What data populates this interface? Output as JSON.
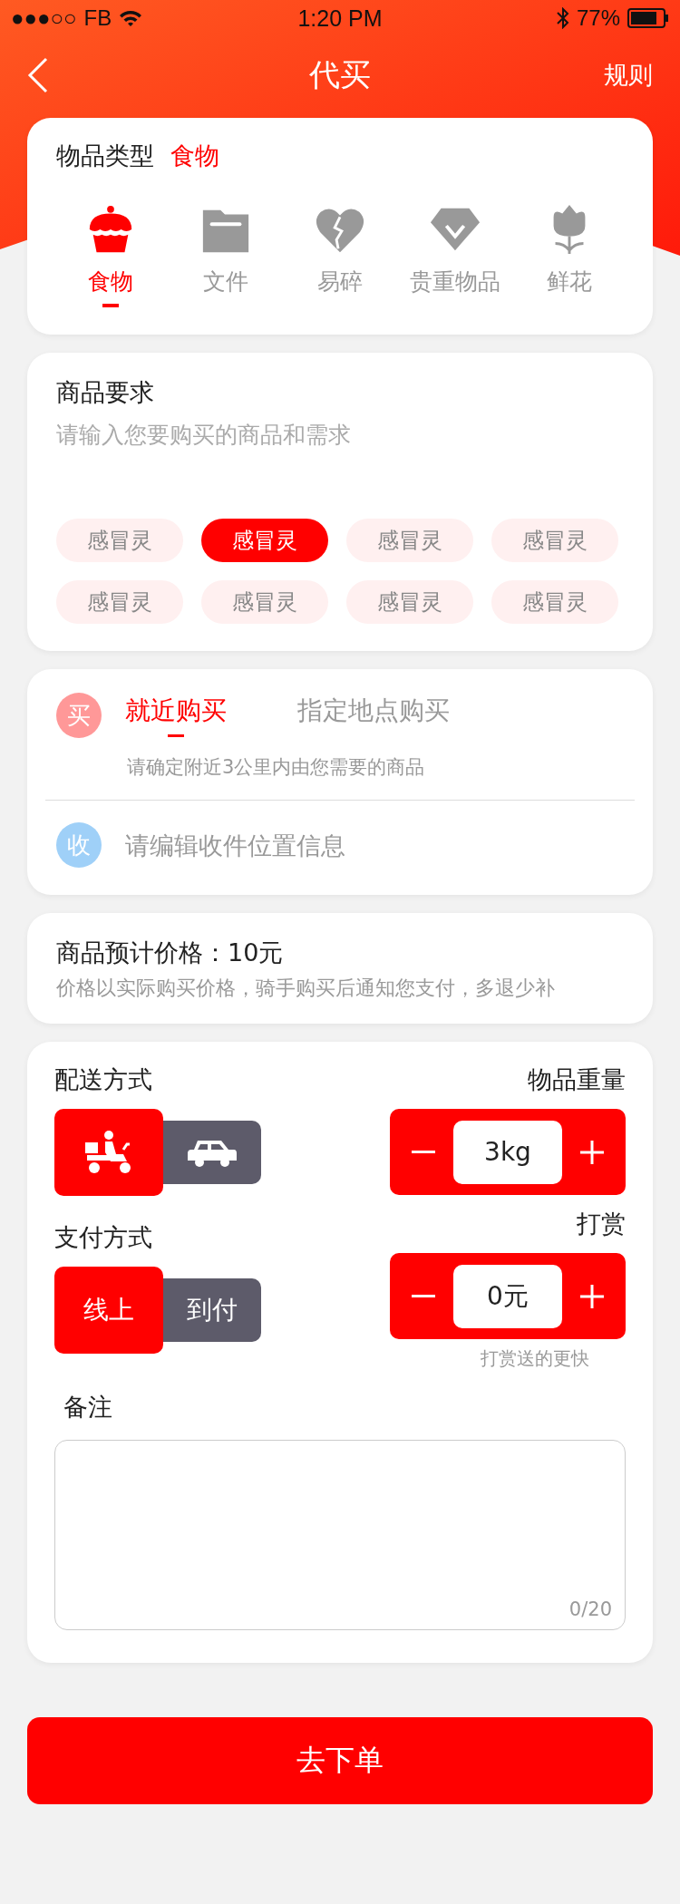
{
  "status_bar": {
    "signal": "●●●○○",
    "carrier": "FB",
    "time": "1:20 PM",
    "battery": "77%"
  },
  "header": {
    "title": "代买",
    "right_link": "规则"
  },
  "item_type": {
    "label": "物品类型",
    "value": "食物",
    "categories": [
      {
        "label": "食物",
        "kind": "cake",
        "selected": true
      },
      {
        "label": "文件",
        "kind": "folder",
        "selected": false
      },
      {
        "label": "易碎",
        "kind": "heart",
        "selected": false
      },
      {
        "label": "贵重物品",
        "kind": "diamond",
        "selected": false
      },
      {
        "label": "鲜花",
        "kind": "tulip",
        "selected": false
      }
    ]
  },
  "requirements": {
    "title": "商品要求",
    "placeholder": "请输入您要购买的商品和需求",
    "tags": [
      {
        "label": "感冒灵",
        "selected": false
      },
      {
        "label": "感冒灵",
        "selected": true
      },
      {
        "label": "感冒灵",
        "selected": false
      },
      {
        "label": "感冒灵",
        "selected": false
      },
      {
        "label": "感冒灵",
        "selected": false
      },
      {
        "label": "感冒灵",
        "selected": false
      },
      {
        "label": "感冒灵",
        "selected": false
      },
      {
        "label": "感冒灵",
        "selected": false
      }
    ]
  },
  "purchase": {
    "badge": "买",
    "tabs": [
      {
        "label": "就近购买",
        "selected": true
      },
      {
        "label": "指定地点购买",
        "selected": false
      }
    ],
    "hint": "请确定附近3公里内由您需要的商品",
    "receive_badge": "收",
    "address_placeholder": "请编辑收件位置信息"
  },
  "price": {
    "title": "商品预计价格：10元",
    "note": "价格以实际购买价格，骑手购买后通知您支付，多退少补"
  },
  "delivery": {
    "label": "配送方式",
    "options": [
      {
        "kind": "scooter",
        "selected": true
      },
      {
        "kind": "car",
        "selected": false
      }
    ],
    "weight_label": "物品重量",
    "weight_value": "3kg",
    "payment_label": "支付方式",
    "payment_options": [
      {
        "label": "线上",
        "selected": true
      },
      {
        "label": "到付",
        "selected": false
      }
    ],
    "tip_label": "打赏",
    "tip_value": "0元",
    "tip_note": "打赏送的更快",
    "remark_label": "备注",
    "remark_counter": "0/20"
  },
  "submit": "去下单"
}
